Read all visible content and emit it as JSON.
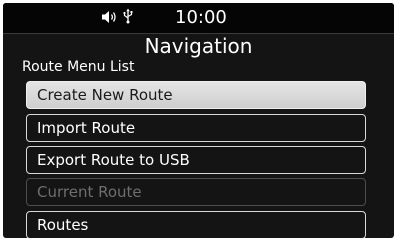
{
  "status_bar": {
    "time": "10:00",
    "icons": [
      "speaker-volume-icon",
      "usb-icon"
    ]
  },
  "header": {
    "title": "Navigation"
  },
  "menu": {
    "section_label": "Route Menu List",
    "items": [
      {
        "label": "Create New Route",
        "state": "selected"
      },
      {
        "label": "Import Route",
        "state": "enabled"
      },
      {
        "label": "Export Route to USB",
        "state": "enabled"
      },
      {
        "label": "Current Route",
        "state": "disabled"
      },
      {
        "label": "Routes",
        "state": "enabled"
      }
    ]
  },
  "colors": {
    "background": "#141414",
    "status_bar": "#050505",
    "text": "#ffffff",
    "border": "#d8d8d8",
    "selected_fill": "#dcdcdc",
    "disabled_text": "#6e6e6e"
  }
}
